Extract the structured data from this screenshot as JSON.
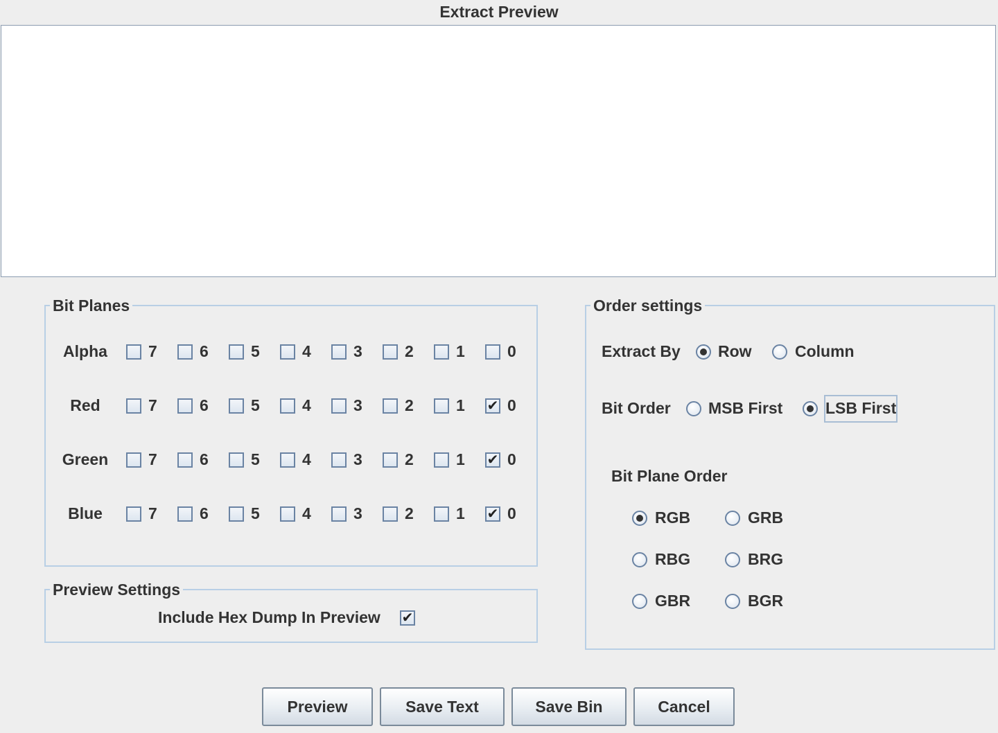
{
  "window": {
    "title": "Extract Preview"
  },
  "preview": {
    "content": ""
  },
  "bit_planes": {
    "title": "Bit Planes",
    "bits": [
      "7",
      "6",
      "5",
      "4",
      "3",
      "2",
      "1",
      "0"
    ],
    "rows": [
      {
        "label": "Alpha",
        "checked": []
      },
      {
        "label": "Red",
        "checked": [
          "0"
        ]
      },
      {
        "label": "Green",
        "checked": [
          "0"
        ]
      },
      {
        "label": "Blue",
        "checked": [
          "0"
        ]
      }
    ]
  },
  "preview_settings": {
    "title": "Preview Settings",
    "hex_dump_label": "Include Hex Dump In Preview",
    "hex_dump_checked": true
  },
  "order_settings": {
    "title": "Order settings",
    "extract_by": {
      "label": "Extract By",
      "options": [
        "Row",
        "Column"
      ],
      "selected": "Row"
    },
    "bit_order": {
      "label": "Bit Order",
      "options": [
        "MSB First",
        "LSB First"
      ],
      "selected": "LSB First"
    },
    "bit_plane_order": {
      "label": "Bit Plane Order",
      "options": [
        "RGB",
        "GRB",
        "RBG",
        "BRG",
        "GBR",
        "BGR"
      ],
      "selected": "RGB"
    }
  },
  "buttons": {
    "preview": "Preview",
    "save_text": "Save Text",
    "save_bin": "Save Bin",
    "cancel": "Cancel"
  }
}
